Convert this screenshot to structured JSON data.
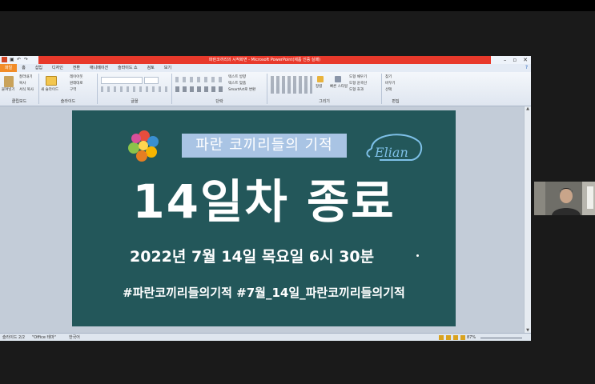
{
  "window": {
    "title": "파란코끼리의 시작화면 - Microsoft PowerPoint(제품 인증 실패)"
  },
  "ribbon_tabs": [
    "파일",
    "홈",
    "삽입",
    "디자인",
    "전환",
    "애니메이션",
    "슬라이드 쇼",
    "검토",
    "보기"
  ],
  "ribbon": {
    "clipboard": {
      "paste": "붙여넣기",
      "cut": "잘라내기",
      "copy": "복사",
      "format_painter": "서식 복사",
      "group": "클립보드"
    },
    "slides": {
      "new_slide": "새 슬라이드",
      "layout": "레이아웃",
      "reset": "원래대로",
      "section": "구역",
      "group": "슬라이드"
    },
    "font": {
      "group": "글꼴"
    },
    "paragraph": {
      "text_direction": "텍스트 방향",
      "align_text": "텍스트 맞춤",
      "smartart": "SmartArt로 변환",
      "group": "단락"
    },
    "drawing": {
      "arrange": "정렬",
      "quick_styles": "빠른 스타일",
      "shape_fill": "도형 채우기",
      "shape_outline": "도형 윤곽선",
      "shape_effects": "도형 효과",
      "group": "그리기"
    },
    "editing": {
      "find": "찾기",
      "replace": "바꾸기",
      "select": "선택",
      "group": "편집"
    }
  },
  "status": {
    "slide": "슬라이드 2/2",
    "theme": "\"Office 테마\"",
    "language": "한국어",
    "zoom": "87%"
  },
  "slide": {
    "title": "파란 코끼리들의 기적",
    "heading": "14일차 종료",
    "date": "2022년 7월 14일 목요일 6시 30분",
    "hashtags": "#파란코끼리들의기적 #7월_14일_파란코끼리들의기적",
    "logo_text": "Elian"
  },
  "colors": {
    "title_bar": "#e8392b",
    "file_tab": "#f28c28",
    "slide_bg": "#23575a",
    "title_highlight": "#a9c4e4"
  }
}
